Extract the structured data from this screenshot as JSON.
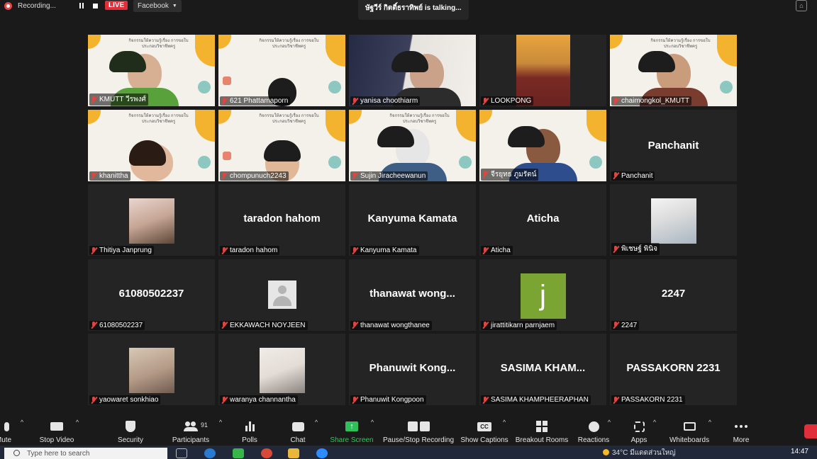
{
  "topbar": {
    "recording_label": "Recording...",
    "live_badge": "LIVE",
    "live_target": "Facebook",
    "talking": "ษัฐวีร์ กิตติ์ธราทิพย์ is talking..."
  },
  "banner_text": "กิจกรรมให้ความรู้เรื่อง การขอใบประกอบวิชาชีพครู",
  "tiles": [
    {
      "name": "KMUTT วีรพงศ์"
    },
    {
      "name": "621 Phattamaporn"
    },
    {
      "name": "yanisa choothiarm"
    },
    {
      "name": "LOOKPONG"
    },
    {
      "name": "chaimongkol_KMUTT"
    },
    {
      "name": "khanittha"
    },
    {
      "name": "chompunuch2243"
    },
    {
      "name": "Sujin Jiracheewanun"
    },
    {
      "name": "จีรยุทธ ภูมรัตน์"
    },
    {
      "name": "Panchanit",
      "display": "Panchanit"
    },
    {
      "name": "Thitiya Janprung"
    },
    {
      "name": "taradon hahom",
      "display": "taradon hahom"
    },
    {
      "name": "Kanyuma Kamata",
      "display": "Kanyuma Kamata"
    },
    {
      "name": "Aticha",
      "display": "Aticha"
    },
    {
      "name": "พิเชษฐ์ พินิจ"
    },
    {
      "name": "61080502237",
      "display": "61080502237"
    },
    {
      "name": "EKKAWACH NOYJEEN"
    },
    {
      "name": "thanawat wongthanee",
      "display": "thanawat wong..."
    },
    {
      "name": "jirattitikarn parnjaem",
      "avatar_letter": "j"
    },
    {
      "name": "2247",
      "display": "2247"
    },
    {
      "name": "yaowaret sonkhiao"
    },
    {
      "name": "waranya channantha"
    },
    {
      "name": "Phanuwit Kongpoon",
      "display": "Phanuwit Kong..."
    },
    {
      "name": "SASIMA KHAMPHEERAPHAN",
      "display": "SASIMA KHAM..."
    },
    {
      "name": "PASSAKORN 2231",
      "display": "PASSAKORN 2231"
    }
  ],
  "toolbar": {
    "mute": "Mute",
    "stop_video": "Stop Video",
    "security": "Security",
    "participants": "Participants",
    "participants_count": "91",
    "polls": "Polls",
    "chat": "Chat",
    "share_screen": "Share Screen",
    "pause_recording": "Pause/Stop Recording",
    "captions": "Show Captions",
    "breakout": "Breakout Rooms",
    "reactions": "Reactions",
    "apps": "Apps",
    "whiteboards": "Whiteboards",
    "more": "More"
  },
  "taskbar": {
    "search_placeholder": "Type here to search",
    "weather": "34°C มีแดดส่วนใหญ่",
    "time": "14:47"
  },
  "colors": {
    "accent_green": "#32c55b",
    "live_red": "#e02f3b",
    "muted_red": "#e0463f"
  }
}
